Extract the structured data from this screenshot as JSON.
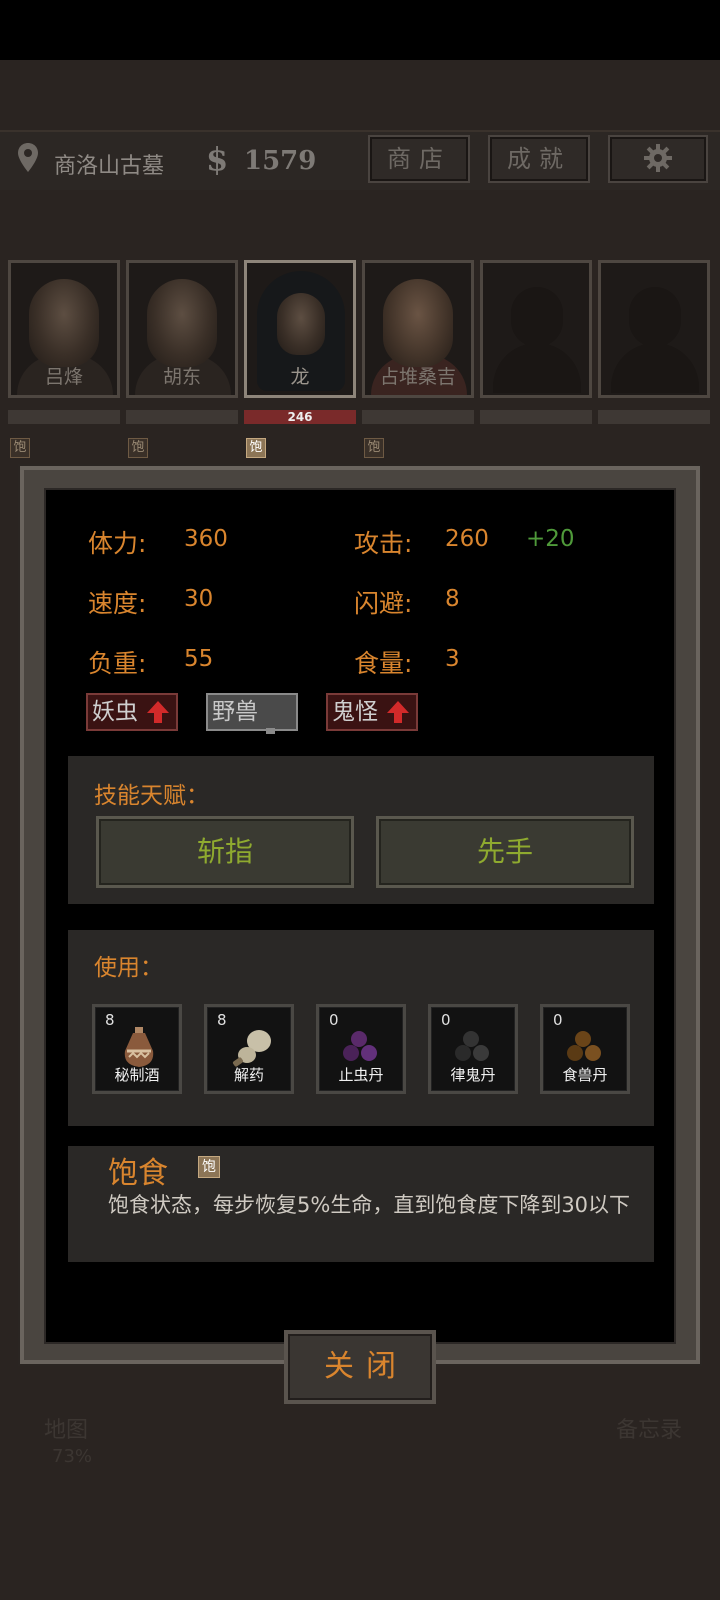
{
  "header": {
    "location": "商洛山古墓",
    "money_symbol": "$",
    "money": "1579",
    "shop_label": "商店",
    "achievements_label": "成就",
    "settings_icon": "gear-icon",
    "location_icon": "map-pin-icon"
  },
  "party": [
    {
      "name": "吕烽",
      "hp_text": "",
      "selected": false,
      "full_badge": "饱"
    },
    {
      "name": "胡东",
      "hp_text": "",
      "selected": false,
      "full_badge": "饱"
    },
    {
      "name": "龙",
      "hp_text": "246",
      "selected": true,
      "full_badge": "饱"
    },
    {
      "name": "占堆桑吉",
      "hp_text": "",
      "selected": false,
      "full_badge": "饱"
    },
    {
      "name": "",
      "hp_text": "",
      "selected": false,
      "full_badge": ""
    },
    {
      "name": "",
      "hp_text": "",
      "selected": false,
      "full_badge": ""
    }
  ],
  "background": {
    "map_label": "地图",
    "map_percent": "73%",
    "memo_label": "备忘录"
  },
  "stats": {
    "hp_label": "体力:",
    "hp": "360",
    "attack_label": "攻击:",
    "attack": "260",
    "attack_bonus": "+20",
    "speed_label": "速度:",
    "speed": "30",
    "dodge_label": "闪避:",
    "dodge": "8",
    "load_label": "负重:",
    "load": "55",
    "food_label": "食量:",
    "food": "3"
  },
  "tags": [
    {
      "label": "妖虫",
      "state": "up"
    },
    {
      "label": "野兽",
      "state": "neutral"
    },
    {
      "label": "鬼怪",
      "state": "up"
    }
  ],
  "skills": {
    "title": "技能天赋：",
    "items": [
      "斩指",
      "先手"
    ]
  },
  "use": {
    "title": "使用：",
    "items": [
      {
        "name": "秘制酒",
        "count": "8",
        "icon": "wine-jar-icon"
      },
      {
        "name": "解药",
        "count": "8",
        "icon": "antidote-gourd-icon"
      },
      {
        "name": "止虫丹",
        "count": "0",
        "icon": "purple-pills-icon"
      },
      {
        "name": "律鬼丹",
        "count": "0",
        "icon": "dark-pills-icon"
      },
      {
        "name": "食兽丹",
        "count": "0",
        "icon": "brown-pills-icon"
      }
    ]
  },
  "status": {
    "title": "饱食",
    "badge": "饱",
    "description": "饱食状态，每步恢复5%生命，直到饱食度下降到30以下"
  },
  "close_label": "关闭",
  "colors": {
    "accent_orange": "#d9852e",
    "bonus_green": "#4f9a3a",
    "skill_green": "#8faa2f",
    "hp_bar_red": "#7a2a2a"
  }
}
